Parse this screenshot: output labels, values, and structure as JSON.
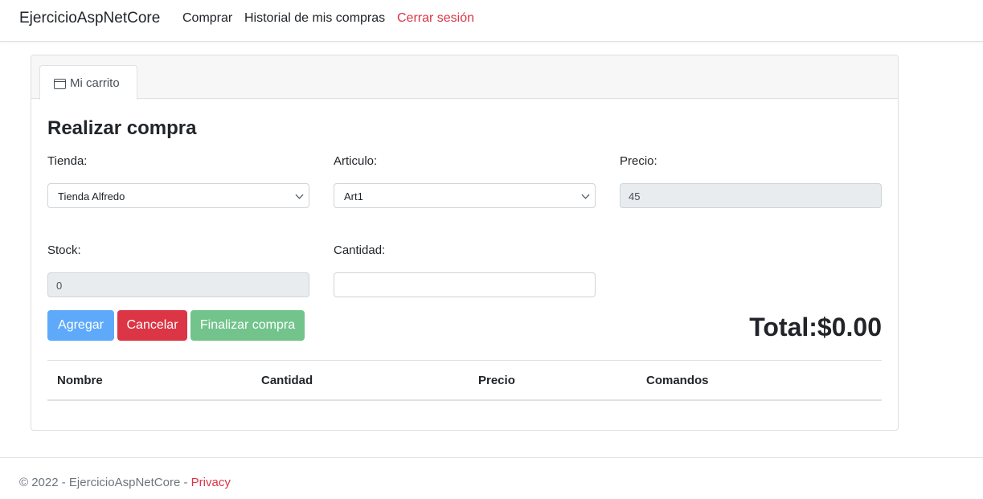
{
  "navbar": {
    "brand": "EjercicioAspNetCore",
    "links": [
      "Comprar",
      "Historial de mis compras"
    ],
    "logout": "Cerrar sesión"
  },
  "tab": {
    "icon": "card-icon",
    "label": "Mi carrito"
  },
  "form": {
    "title": "Realizar compra",
    "tienda": {
      "label": "Tienda:",
      "value": "Tienda Alfredo"
    },
    "articulo": {
      "label": "Articulo:",
      "value": "Art1"
    },
    "precio": {
      "label": "Precio:",
      "value": "45"
    },
    "stock": {
      "label": "Stock:",
      "value": "0"
    },
    "cantidad": {
      "label": "Cantidad:",
      "value": ""
    }
  },
  "buttons": {
    "agregar": "Agregar",
    "cancelar": "Cancelar",
    "finalizar": "Finalizar compra"
  },
  "total": "Total:$0.00",
  "table": {
    "headers": [
      "Nombre",
      "Cantidad",
      "Precio",
      "Comandos"
    ],
    "rows": []
  },
  "footer": {
    "text": "© 2022 - EjercicioAspNetCore - ",
    "link": "Privacy"
  },
  "colors": {
    "primary": "#5ea9f9",
    "danger": "#dc3545",
    "success": "#72c48c"
  }
}
